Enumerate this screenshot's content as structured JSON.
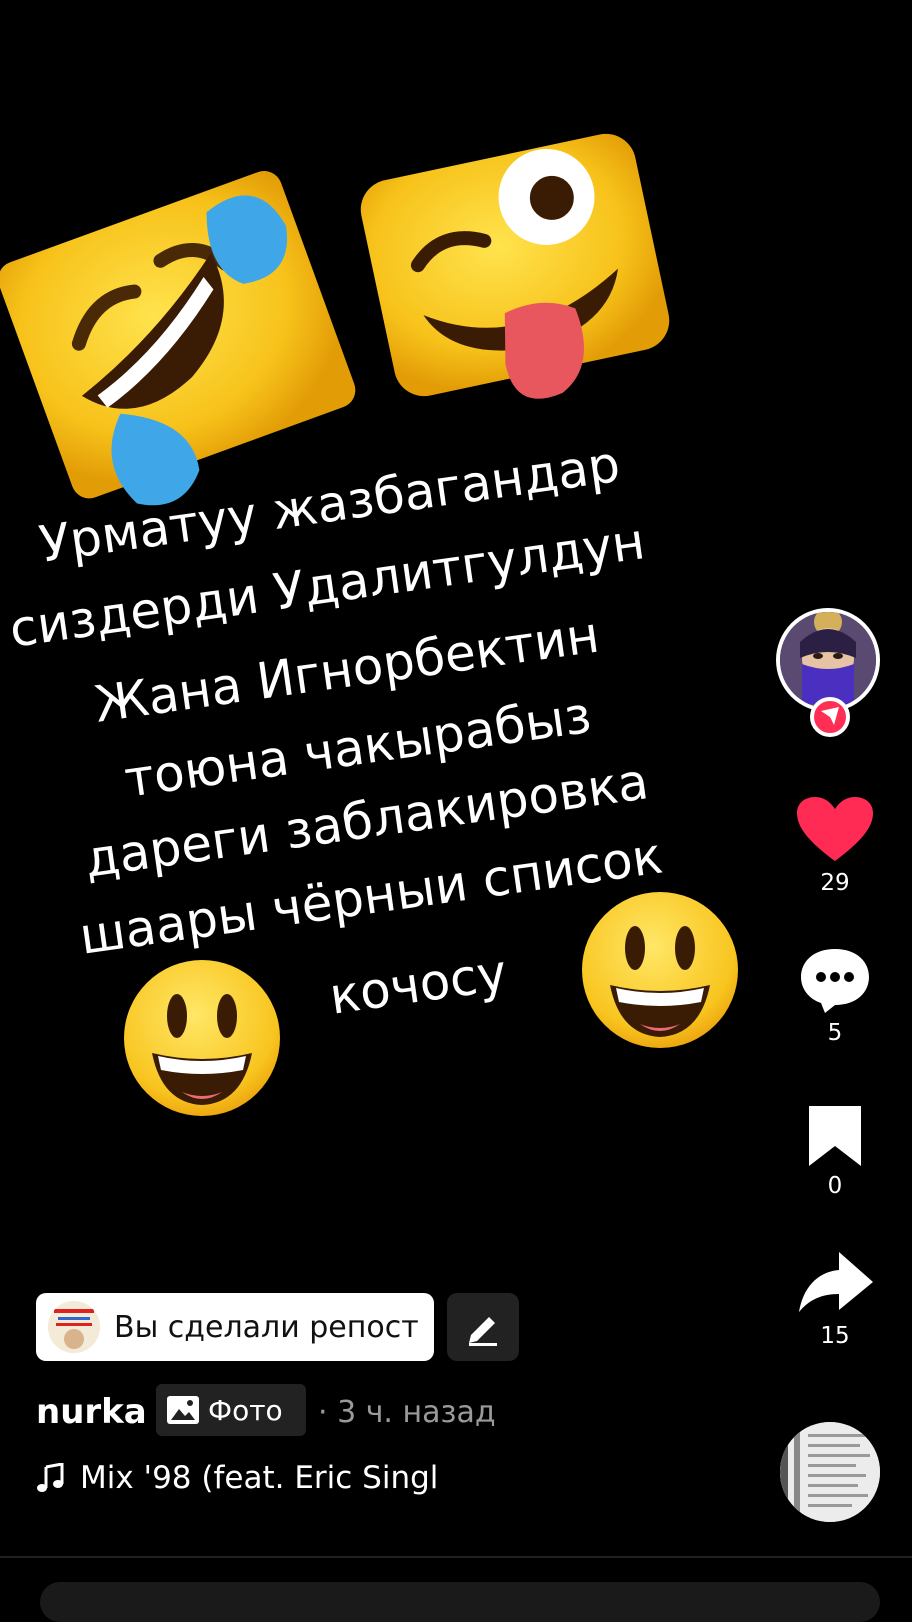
{
  "post": {
    "caption_lines": [
      "Урматуу жазбагандар",
      "сиздерди Удалитгулдун",
      "Жана Игнорбектин",
      "тоюна чакырабыз",
      "дареги заблакировка",
      "шаары чёрныи список",
      "кочосу"
    ],
    "stickers": [
      "rofl-emoji",
      "zany-face-emoji",
      "grinning-face-emoji",
      "grinning-face-emoji"
    ]
  },
  "actions": {
    "likes": "29",
    "comments": "5",
    "saves": "0",
    "shares": "15",
    "like_color": "#ff2b55",
    "follow_badge_color": "#ff2e55"
  },
  "repost": {
    "label": "Вы сделали репост"
  },
  "info": {
    "author": "nurka",
    "media_type": "Фото",
    "time_ago": "· 3 ч. назад",
    "music_title": "Mix '98 (feat. Eric Singl"
  }
}
